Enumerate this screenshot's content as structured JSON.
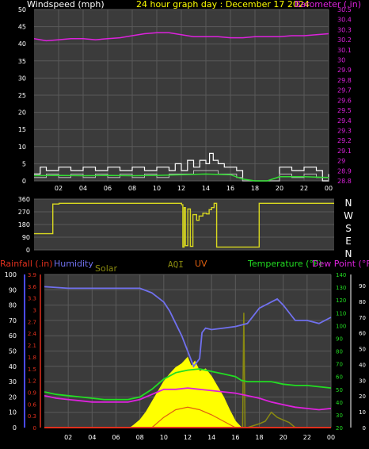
{
  "header": {
    "wind_label": "Windspeed (mph)",
    "title": "24 hour graph day : December 17 2024",
    "baro_label": "Barometer (.in)"
  },
  "lower_header": {
    "rain_label": "Rainfall (.in)",
    "humidity_label": "Humidity",
    "solar_label": "Solar",
    "aqi_label": "AQI",
    "uv_label": "UV",
    "temp_label": "Temperature (°F)",
    "dew_label": "Dew Point (°F)"
  },
  "colors": {
    "background": "#000000",
    "plot_bg": "#3b3b3b",
    "grid": "#5a5a5a",
    "wind": "#ffffff",
    "gust": "#ffffff",
    "wind_avg": "#33dd33",
    "barometer": "#dd22dd",
    "direction": "#d8d820",
    "rain": "#e0301e",
    "humidity": "#7070ee",
    "solar": "#ffff00",
    "aqi": "#8a8a10",
    "uv": "#e06010",
    "temperature": "#22dd22",
    "dewpoint": "#dd22dd",
    "title": "#ffff00"
  },
  "chart_data": [
    {
      "type": "line",
      "name": "wind-barometer",
      "x_ticks": [
        "02",
        "04",
        "06",
        "08",
        "10",
        "12",
        "14",
        "16",
        "18",
        "20",
        "22",
        "00"
      ],
      "ylim_left": [
        0,
        50
      ],
      "y_ticks_left": [
        "50",
        "45",
        "40",
        "35",
        "30",
        "25",
        "20",
        "15",
        "10",
        "5",
        "0"
      ],
      "ylim_right": [
        28.8,
        30.5
      ],
      "y_ticks_right": [
        "30.5",
        "30.4",
        "30.3",
        "30.2",
        "30.1",
        "30",
        "29.9",
        "29.8",
        "29.7",
        "29.6",
        "29.5",
        "29.4",
        "29.3",
        "29.2",
        "29.1",
        "29",
        "28.9",
        "28.8"
      ],
      "barometer": {
        "x": [
          0,
          1,
          2,
          3,
          4,
          5,
          6,
          7,
          8,
          9,
          10,
          11,
          12,
          13,
          14,
          15,
          16,
          17,
          18,
          19,
          20,
          21,
          22,
          23,
          24
        ],
        "values": [
          30.21,
          30.19,
          30.2,
          30.21,
          30.21,
          30.2,
          30.21,
          30.22,
          30.24,
          30.26,
          30.27,
          30.27,
          30.25,
          30.23,
          30.23,
          30.23,
          30.22,
          30.22,
          30.23,
          30.23,
          30.23,
          30.24,
          30.24,
          30.25,
          30.26
        ]
      },
      "wind_gust": {
        "x": [
          0,
          0.5,
          1,
          2,
          3,
          4,
          5,
          6,
          7,
          8,
          9,
          10,
          11,
          11.5,
          12,
          12.5,
          13,
          13.5,
          14,
          14.3,
          14.6,
          15,
          15.5,
          16,
          16.5,
          17,
          18,
          19,
          20,
          21,
          22,
          23,
          23.5,
          24
        ],
        "values": [
          2,
          4,
          3,
          4,
          3,
          4,
          3,
          4,
          3,
          4,
          3,
          4,
          3,
          5,
          3,
          6,
          4,
          6,
          5,
          8,
          6,
          5,
          4,
          4,
          3,
          0,
          0,
          0,
          4,
          3,
          4,
          3,
          0,
          2
        ]
      },
      "wind_speed": {
        "x": [
          0,
          1,
          2,
          3,
          4,
          5,
          6,
          7,
          8,
          9,
          10,
          11,
          12,
          13,
          14,
          15,
          16,
          16.5,
          17,
          18,
          19,
          20,
          21,
          22,
          23,
          24
        ],
        "values": [
          1,
          2,
          1,
          2,
          1,
          2,
          1,
          2,
          1,
          2,
          1,
          2,
          2,
          3,
          3,
          2,
          2,
          1,
          0,
          0,
          0,
          2,
          1,
          2,
          1,
          0
        ]
      },
      "wind_average": {
        "x": [
          0,
          2,
          4,
          6,
          8,
          10,
          12,
          14,
          16,
          17,
          18,
          19,
          20,
          22,
          24
        ],
        "values": [
          1.5,
          1.6,
          1.5,
          1.6,
          1.5,
          1.6,
          1.8,
          2,
          1.8,
          0.5,
          0,
          0,
          1.2,
          1.2,
          1.0
        ]
      }
    },
    {
      "type": "line",
      "name": "wind-direction",
      "x_ticks": [],
      "ylim": [
        0,
        360
      ],
      "y_ticks_left": [
        "360",
        "270",
        "180",
        "90",
        "0"
      ],
      "y_ticks_right": [
        "N",
        "W",
        "S",
        "E",
        "N"
      ],
      "direction": {
        "x": [
          0,
          1.4,
          1.5,
          2,
          4,
          6,
          8,
          10,
          11.5,
          11.8,
          11.9,
          12,
          12.1,
          12.3,
          12.5,
          12.7,
          13,
          13.2,
          13.5,
          13.8,
          14,
          14.2,
          14.4,
          14.6,
          15,
          16,
          16.4,
          17.5,
          18,
          20,
          22,
          24
        ],
        "values": [
          115,
          115,
          325,
          330,
          330,
          330,
          330,
          330,
          330,
          320,
          20,
          300,
          30,
          290,
          25,
          250,
          210,
          240,
          260,
          255,
          285,
          300,
          330,
          20,
          20,
          20,
          20,
          20,
          330,
          330,
          330,
          330
        ]
      }
    },
    {
      "type": "area",
      "name": "rain-humidity-temperature",
      "x_ticks": [
        "02",
        "04",
        "06",
        "08",
        "10",
        "12",
        "14",
        "16",
        "18",
        "20",
        "22",
        "00"
      ],
      "ylim_rain": [
        0,
        3.9
      ],
      "y_ticks_rain": [
        "3.9",
        "3.6",
        "3.3",
        "3",
        "2.7",
        "2.4",
        "2.1",
        "1.8",
        "1.5",
        "1.2",
        "0.9",
        "0.6",
        "0.3",
        "0"
      ],
      "ylim_humidity": [
        0,
        100
      ],
      "y_ticks_humidity": [
        "100",
        "90",
        "80",
        "70",
        "60",
        "50",
        "40",
        "30",
        "20",
        "10",
        "0"
      ],
      "ylim_temp": [
        20,
        140
      ],
      "y_ticks_temp": [
        "140",
        "130",
        "120",
        "110",
        "100",
        "90",
        "80",
        "70",
        "60",
        "50",
        "40",
        "30",
        "20"
      ],
      "y_ticks_extra": [
        "90",
        "80",
        "70",
        "60",
        "50",
        "40",
        "30",
        "20",
        "10",
        "0"
      ],
      "humidity": {
        "x": [
          0,
          2,
          4,
          6,
          8,
          9,
          10,
          10.5,
          11,
          11.5,
          12,
          12.5,
          13,
          13.2,
          13.5,
          14,
          15,
          16,
          17,
          18,
          19,
          19.5,
          20,
          21,
          22,
          23,
          24
        ],
        "values": [
          92,
          91,
          91,
          91,
          91,
          88,
          82,
          76,
          68,
          60,
          50,
          40,
          45,
          62,
          65,
          64,
          65,
          66,
          68,
          78,
          82,
          84,
          80,
          70,
          70,
          68,
          72
        ]
      },
      "temperature": {
        "x": [
          0,
          1,
          2,
          3,
          4,
          5,
          6,
          7,
          8,
          9,
          10,
          11,
          12,
          13,
          14,
          15,
          16,
          16.5,
          17,
          18,
          19,
          20,
          21,
          22,
          23,
          24
        ],
        "values": [
          48,
          46,
          45,
          44,
          43,
          42,
          42,
          42,
          44,
          50,
          58,
          63,
          65,
          66,
          64,
          62,
          60,
          57,
          56,
          56,
          56,
          54,
          53,
          53,
          52,
          51
        ]
      },
      "dewpoint": {
        "x": [
          0,
          1,
          2,
          3,
          4,
          5,
          6,
          7,
          8,
          9,
          10,
          11,
          12,
          13,
          14,
          15,
          16,
          17,
          18,
          19,
          20,
          21,
          22,
          23,
          24
        ],
        "values": [
          45,
          43,
          42,
          41,
          40,
          40,
          40,
          40,
          42,
          46,
          50,
          50,
          51,
          50,
          49,
          48,
          47,
          45,
          43,
          40,
          38,
          36,
          35,
          34,
          35
        ]
      },
      "solar": {
        "x": [
          7.2,
          7.5,
          8,
          8.5,
          9,
          9.5,
          10,
          10.5,
          11,
          11.5,
          12,
          12.3,
          12.6,
          13,
          13.5,
          14,
          14.5,
          15,
          15.5,
          16,
          16.5
        ],
        "values": [
          0,
          2,
          6,
          12,
          20,
          28,
          36,
          42,
          47,
          50,
          55,
          48,
          52,
          44,
          46,
          40,
          32,
          24,
          14,
          5,
          0
        ]
      },
      "uv": {
        "x": [
          9,
          10,
          11,
          12,
          13,
          14,
          15,
          16
        ],
        "values": [
          0,
          8,
          14,
          16,
          14,
          10,
          5,
          0
        ]
      },
      "aqi": {
        "x": [
          0,
          16.6,
          16.7,
          16.8,
          17,
          18,
          18.5,
          19,
          19.5,
          20,
          20.5,
          21,
          24
        ],
        "values": [
          0,
          0,
          90,
          0,
          0,
          3,
          5,
          12,
          8,
          6,
          4,
          0,
          0
        ]
      },
      "rain": {
        "x": [
          0,
          24
        ],
        "values": [
          0,
          0
        ]
      }
    }
  ]
}
